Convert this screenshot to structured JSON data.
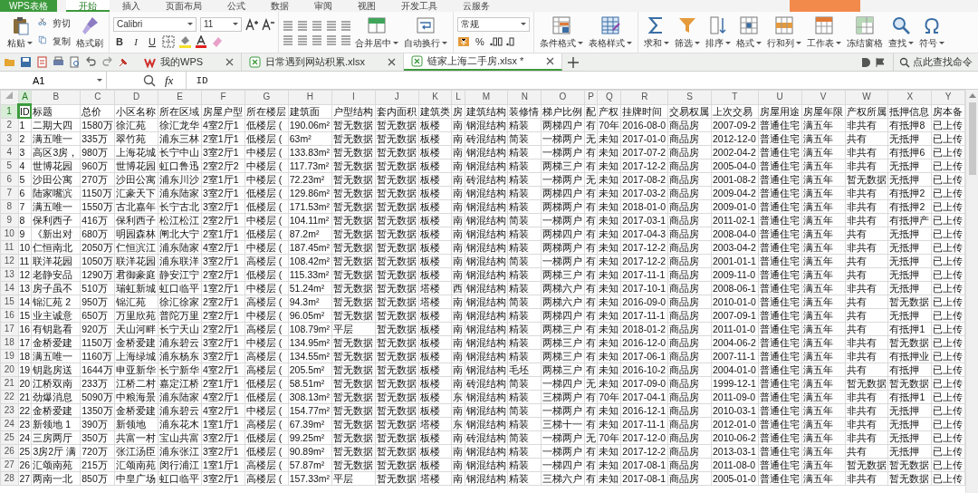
{
  "app": {
    "logo": "WPS表格"
  },
  "ribbon_tabs": [
    {
      "label": "开始",
      "selected": true
    },
    {
      "label": "插入",
      "selected": false
    },
    {
      "label": "页面布局",
      "selected": false
    },
    {
      "label": "公式",
      "selected": false
    },
    {
      "label": "数据",
      "selected": false
    },
    {
      "label": "审阅",
      "selected": false
    },
    {
      "label": "视图",
      "selected": false
    },
    {
      "label": "开发工具",
      "selected": false
    },
    {
      "label": "云服务",
      "selected": false
    }
  ],
  "ribbon": {
    "paste": {
      "label": "粘贴"
    },
    "small_tools": [
      {
        "label": "剪切"
      },
      {
        "label": "复制"
      }
    ],
    "brush": {
      "label": "格式刷"
    },
    "font_name": "Calibri",
    "font_size": "11",
    "format_buttons": [
      {
        "label": "B",
        "kind": "bold"
      },
      {
        "label": "I",
        "kind": "italic"
      },
      {
        "label": "U",
        "kind": "underline"
      }
    ],
    "merge_buttons": [
      {
        "label": "合并居中"
      },
      {
        "label": "自动换行"
      }
    ],
    "number_format": "常规",
    "percent": "%",
    "tools": [
      {
        "label": "条件格式",
        "caret": true
      },
      {
        "label": "表格样式",
        "caret": true
      },
      {
        "label": "求和",
        "caret": true
      },
      {
        "label": "筛选",
        "caret": true
      },
      {
        "label": "排序",
        "caret": true
      },
      {
        "label": "格式",
        "caret": true
      },
      {
        "label": "行和列",
        "caret": true
      },
      {
        "label": "工作表",
        "caret": true
      },
      {
        "label": "冻结窗格",
        "caret": false
      },
      {
        "label": "查找",
        "caret": true
      },
      {
        "label": "符号",
        "caret": true
      }
    ]
  },
  "doc_tabs": [
    {
      "label": "我的WPS",
      "selected": false
    },
    {
      "label": "日常遇到网站积累.xlsx",
      "selected": false
    },
    {
      "label": "链家上海二手房.xlsx *",
      "selected": true
    }
  ],
  "command_search": {
    "label": "点此查找命令"
  },
  "formula_bar": {
    "name_box": "A1",
    "fx": "fx",
    "formula": "ID"
  },
  "sheet": {
    "columns": [
      {
        "letter": "A",
        "selected": true
      },
      {
        "letter": "B",
        "selected": false
      },
      {
        "letter": "C",
        "selected": false
      },
      {
        "letter": "D",
        "selected": false
      },
      {
        "letter": "E",
        "selected": false
      },
      {
        "letter": "F",
        "selected": false
      },
      {
        "letter": "G",
        "selected": false
      },
      {
        "letter": "H",
        "selected": false
      },
      {
        "letter": "I",
        "selected": false
      },
      {
        "letter": "J",
        "selected": false
      },
      {
        "letter": "K",
        "selected": false
      },
      {
        "letter": "L",
        "selected": false
      },
      {
        "letter": "M",
        "selected": false
      },
      {
        "letter": "N",
        "selected": false
      },
      {
        "letter": "O",
        "selected": false
      },
      {
        "letter": "P",
        "selected": false
      },
      {
        "letter": "Q",
        "selected": false
      },
      {
        "letter": "R",
        "selected": false
      },
      {
        "letter": "S",
        "selected": false
      },
      {
        "letter": "T",
        "selected": false
      },
      {
        "letter": "U",
        "selected": false
      },
      {
        "letter": "V",
        "selected": false
      },
      {
        "letter": "W",
        "selected": false
      },
      {
        "letter": "X",
        "selected": false
      },
      {
        "letter": "Y",
        "selected": false
      }
    ],
    "rows": [
      {
        "number": "1",
        "selected": true,
        "cells": [
          "ID",
          "标题",
          "总价",
          "小区名称",
          "所在区域",
          "房屋户型",
          "所在楼层",
          "建筑面",
          "户型结构",
          "套内面积",
          "建筑类",
          "房",
          "建筑结构",
          "装修情",
          "梯户比例",
          "配",
          "产权",
          "挂牌时间",
          "交易权属",
          "上次交易",
          "房屋用途",
          "房屋年限",
          "产权所属",
          "抵押信息",
          "房本备"
        ]
      },
      {
        "number": "2",
        "selected": false,
        "cells": [
          "1",
          "二期大四",
          "1580万",
          "徐汇苑",
          "徐汇龙华",
          "4室2厅1",
          "低楼层 (",
          "190.06m²",
          "暂无数据",
          "暂无数据",
          "板楼",
          "南",
          "钢混结构",
          "精装",
          "两梯四户",
          "有",
          "70年",
          "2016-08-0",
          "商品房",
          "2007-09-2",
          "普通住宅",
          "满五年",
          "非共有",
          "有抵押8",
          "已上传"
        ]
      },
      {
        "number": "3",
        "selected": false,
        "cells": [
          "2",
          "满五唯一",
          "335万",
          "翠竹苑",
          "浦东三林",
          "2室1厅1",
          "低楼层 (",
          "63m²",
          "暂无数据",
          "暂无数据",
          "板楼",
          "南",
          "砖混结构",
          "简装",
          "一梯两户",
          "无",
          "未知",
          "2017-01-0",
          "商品房",
          "2012-12-0",
          "普通住宅",
          "满五年",
          "共有",
          "无抵押",
          "已上传"
        ]
      },
      {
        "number": "4",
        "selected": false,
        "cells": [
          "3",
          "高区3房，",
          "980万",
          "上海花城",
          "长宁中山",
          "3室2厅1",
          "中楼层 (",
          "133.83m²",
          "暂无数据",
          "暂无数据",
          "板楼",
          "南",
          "钢混结构",
          "精装",
          "一梯两户",
          "有",
          "未知",
          "2017-07-2",
          "商品房",
          "2002-04-2",
          "普通住宅",
          "满五年",
          "非共有",
          "有抵押6",
          "已上传"
        ]
      },
      {
        "number": "5",
        "selected": false,
        "cells": [
          "4",
          "世博花园",
          "960万",
          "世博花园",
          "虹口鲁迅",
          "2室2厅2",
          "中楼层 (",
          "117.73m²",
          "暂无数据",
          "暂无数据",
          "板楼",
          "南",
          "钢混结构",
          "精装",
          "两梯三户",
          "有",
          "未知",
          "2017-12-2",
          "商品房",
          "2005-04-0",
          "普通住宅",
          "满五年",
          "非共有",
          "无抵押",
          "已上传"
        ]
      },
      {
        "number": "6",
        "selected": false,
        "cells": [
          "5",
          "沙田公寓",
          "270万",
          "沙田公寓",
          "浦东川沙",
          "2室1厅1",
          "中楼层 (",
          "72.23m²",
          "暂无数据",
          "暂无数据",
          "板楼",
          "南",
          "砖混结构",
          "精装",
          "一梯两户",
          "无",
          "未知",
          "2017-08-2",
          "商品房",
          "2001-08-2",
          "普通住宅",
          "满五年",
          "暂无数据",
          "无抵押",
          "已上传"
        ]
      },
      {
        "number": "7",
        "selected": false,
        "cells": [
          "6",
          "陆家嘴滨",
          "1150万",
          "汇豪天下",
          "浦东陆家",
          "3室2厅1",
          "低楼层 (",
          "129.86m²",
          "暂无数据",
          "暂无数据",
          "板楼",
          "南",
          "钢混结构",
          "精装",
          "两梯四户",
          "有",
          "未知",
          "2017-03-2",
          "商品房",
          "2009-04-2",
          "普通住宅",
          "满五年",
          "非共有",
          "有抵押2",
          "已上传"
        ]
      },
      {
        "number": "8",
        "selected": false,
        "cells": [
          "7",
          "满五唯一",
          "1550万",
          "古北嘉年",
          "长宁古北",
          "3室2厅1",
          "低楼层 (",
          "171.53m²",
          "暂无数据",
          "暂无数据",
          "板楼",
          "南",
          "钢混结构",
          "精装",
          "两梯两户",
          "有",
          "未知",
          "2018-01-0",
          "商品房",
          "2009-01-0",
          "普通住宅",
          "满五年",
          "非共有",
          "有抵押2",
          "已上传"
        ]
      },
      {
        "number": "9",
        "selected": false,
        "cells": [
          "8",
          "保利西子",
          "416万",
          "保利西子",
          "松江松江",
          "2室2厅1",
          "中楼层 (",
          "104.11m²",
          "暂无数据",
          "暂无数据",
          "板楼",
          "南",
          "钢混结构",
          "简装",
          "一梯两户",
          "有",
          "未知",
          "2017-03-1",
          "商品房",
          "2011-02-1",
          "普通住宅",
          "满五年",
          "非共有",
          "有抵押产",
          "已上传"
        ]
      },
      {
        "number": "10",
        "selected": false,
        "cells": [
          "9",
          "《新出对",
          "680万",
          "明园森林",
          "闸北大宁",
          "2室1厅1",
          "低楼层 (",
          "87.2m²",
          "暂无数据",
          "暂无数据",
          "板楼",
          "南",
          "钢混结构",
          "精装",
          "两梯四户",
          "有",
          "未知",
          "2017-04-3",
          "商品房",
          "2008-04-0",
          "普通住宅",
          "满五年",
          "共有",
          "无抵押",
          "已上传"
        ]
      },
      {
        "number": "11",
        "selected": false,
        "cells": [
          "10",
          "仁恒南北",
          "2050万",
          "仁恒滨江",
          "浦东陆家",
          "4室2厅1",
          "中楼层 (",
          "187.45m²",
          "暂无数据",
          "暂无数据",
          "板楼",
          "南",
          "钢混结构",
          "精装",
          "两梯两户",
          "有",
          "未知",
          "2017-12-2",
          "商品房",
          "2003-04-2",
          "普通住宅",
          "满五年",
          "非共有",
          "无抵押",
          "已上传"
        ]
      },
      {
        "number": "12",
        "selected": false,
        "cells": [
          "11",
          "联洋花园",
          "1050万",
          "联洋花园",
          "浦东联洋",
          "3室2厅1",
          "高楼层 (",
          "108.42m²",
          "暂无数据",
          "暂无数据",
          "板楼",
          "南",
          "钢混结构",
          "简装",
          "一梯两户",
          "有",
          "未知",
          "2017-12-2",
          "商品房",
          "2001-01-1",
          "普通住宅",
          "满五年",
          "共有",
          "无抵押",
          "已上传"
        ]
      },
      {
        "number": "13",
        "selected": false,
        "cells": [
          "12",
          "老静安品",
          "1290万",
          "君御豪庭",
          "静安江宁",
          "2室2厅1",
          "低楼层 (",
          "115.33m²",
          "暂无数据",
          "暂无数据",
          "板楼",
          "南",
          "钢混结构",
          "精装",
          "两梯三户",
          "有",
          "未知",
          "2017-11-1",
          "商品房",
          "2009-11-0",
          "普通住宅",
          "满五年",
          "共有",
          "无抵押",
          "已上传"
        ]
      },
      {
        "number": "14",
        "selected": false,
        "cells": [
          "13",
          "房子虽不",
          "510万",
          "瑞虹新城",
          "虹口临平",
          "1室2厅1",
          "中楼层 (",
          "51.24m²",
          "暂无数据",
          "暂无数据",
          "塔楼",
          "西",
          "钢混结构",
          "精装",
          "两梯六户",
          "有",
          "未知",
          "2017-10-1",
          "商品房",
          "2008-06-1",
          "普通住宅",
          "满五年",
          "非共有",
          "无抵押",
          "已上传"
        ]
      },
      {
        "number": "15",
        "selected": false,
        "cells": [
          "14",
          "锦汇苑 2",
          "950万",
          "锦汇苑",
          "徐汇徐家",
          "2室2厅1",
          "高楼层 (",
          "94.3m²",
          "暂无数据",
          "暂无数据",
          "塔楼",
          "南",
          "钢混结构",
          "简装",
          "两梯六户",
          "有",
          "未知",
          "2016-09-0",
          "商品房",
          "2010-01-0",
          "普通住宅",
          "满五年",
          "共有",
          "暂无数据",
          "已上传"
        ]
      },
      {
        "number": "16",
        "selected": false,
        "cells": [
          "15",
          "业主诚意",
          "650万",
          "万里欣苑",
          "普陀万里",
          "2室2厅1",
          "中楼层 (",
          "96.05m²",
          "暂无数据",
          "暂无数据",
          "板楼",
          "南",
          "钢混结构",
          "精装",
          "两梯四户",
          "有",
          "未知",
          "2017-11-1",
          "商品房",
          "2007-09-1",
          "普通住宅",
          "满五年",
          "共有",
          "无抵押",
          "已上传"
        ]
      },
      {
        "number": "17",
        "selected": false,
        "cells": [
          "16",
          "有钥匙看",
          "920万",
          "天山河畔",
          "长宁天山",
          "2室2厅1",
          "高楼层 (",
          "108.79m²",
          "平层",
          "暂无数据",
          "板楼",
          "南",
          "钢混结构",
          "精装",
          "两梯三户",
          "有",
          "未知",
          "2018-01-2",
          "商品房",
          "2011-01-0",
          "普通住宅",
          "满五年",
          "共有",
          "有抵押1",
          "已上传"
        ]
      },
      {
        "number": "18",
        "selected": false,
        "cells": [
          "17",
          "金桥爱建",
          "1150万",
          "金桥爱建",
          "浦东碧云",
          "3室2厅1",
          "中楼层 (",
          "134.95m²",
          "暂无数据",
          "暂无数据",
          "板楼",
          "南",
          "钢混结构",
          "精装",
          "两梯三户",
          "有",
          "未知",
          "2016-12-0",
          "商品房",
          "2004-06-2",
          "普通住宅",
          "满五年",
          "非共有",
          "暂无数据",
          "已上传"
        ]
      },
      {
        "number": "19",
        "selected": false,
        "cells": [
          "18",
          "满五唯一",
          "1160万",
          "上海绿城",
          "浦东杨东",
          "3室2厅1",
          "高楼层 (",
          "134.55m²",
          "暂无数据",
          "暂无数据",
          "板楼",
          "南",
          "钢混结构",
          "精装",
          "两梯三户",
          "有",
          "未知",
          "2017-06-1",
          "商品房",
          "2007-11-1",
          "普通住宅",
          "满五年",
          "非共有",
          "有抵押业",
          "已上传"
        ]
      },
      {
        "number": "20",
        "selected": false,
        "cells": [
          "19",
          "钥匙房送",
          "1644万",
          "申亚新华",
          "长宁新华",
          "4室2厅1",
          "高楼层 (",
          "205.5m²",
          "暂无数据",
          "暂无数据",
          "板楼",
          "南",
          "钢混结构",
          "毛坯",
          "两梯三户",
          "有",
          "未知",
          "2016-10-2",
          "商品房",
          "2004-01-0",
          "普通住宅",
          "满五年",
          "共有",
          "有抵押",
          "已上传"
        ]
      },
      {
        "number": "21",
        "selected": false,
        "cells": [
          "20",
          "江桥双南",
          "233万",
          "江桥二村",
          "嘉定江桥",
          "2室1厅1",
          "低楼层 (",
          "58.51m²",
          "暂无数据",
          "暂无数据",
          "板楼",
          "南",
          "砖混结构",
          "简装",
          "一梯四户",
          "无",
          "未知",
          "2017-09-0",
          "商品房",
          "1999-12-1",
          "普通住宅",
          "满五年",
          "暂无数据",
          "暂无数据",
          "已上传"
        ]
      },
      {
        "number": "22",
        "selected": false,
        "cells": [
          "21",
          "劲爆消息",
          "5090万",
          "中粮海景",
          "浦东陆家",
          "4室2厅1",
          "低楼层 (",
          "308.13m²",
          "暂无数据",
          "暂无数据",
          "板楼",
          "东",
          "钢混结构",
          "精装",
          "三梯两户",
          "有",
          "70年",
          "2017-04-1",
          "商品房",
          "2011-09-0",
          "普通住宅",
          "满五年",
          "非共有",
          "有抵押1",
          "已上传"
        ]
      },
      {
        "number": "23",
        "selected": false,
        "cells": [
          "22",
          "金桥爱建",
          "1350万",
          "金桥爱建",
          "浦东碧云",
          "4室2厅1",
          "中楼层 (",
          "154.77m²",
          "暂无数据",
          "暂无数据",
          "板楼",
          "南",
          "钢混结构",
          "简装",
          "一梯两户",
          "有",
          "未知",
          "2016-12-1",
          "商品房",
          "2010-03-1",
          "普通住宅",
          "满五年",
          "非共有",
          "无抵押",
          "已上传"
        ]
      },
      {
        "number": "24",
        "selected": false,
        "cells": [
          "23",
          "新领地 1",
          "390万",
          "新领地",
          "浦东花木",
          "1室1厅1",
          "高楼层 (",
          "67.39m²",
          "暂无数据",
          "暂无数据",
          "塔楼",
          "东",
          "钢混结构",
          "精装",
          "三梯十一",
          "有",
          "未知",
          "2017-11-1",
          "商品房",
          "2012-01-0",
          "普通住宅",
          "满五年",
          "非共有",
          "无抵押",
          "已上传"
        ]
      },
      {
        "number": "25",
        "selected": false,
        "cells": [
          "24",
          "三房两厅",
          "350万",
          "共富一村",
          "宝山共富",
          "3室2厅1",
          "低楼层 (",
          "99.25m²",
          "暂无数据",
          "暂无数据",
          "板楼",
          "南",
          "砖混结构",
          "简装",
          "一梯两户",
          "无",
          "70年",
          "2017-12-0",
          "商品房",
          "2010-06-2",
          "普通住宅",
          "满五年",
          "非共有",
          "无抵押",
          "已上传"
        ]
      },
      {
        "number": "26",
        "selected": false,
        "cells": [
          "25",
          "3房2厅 满",
          "720万",
          "张江汤臣",
          "浦东张江",
          "3室2厅1",
          "低楼层 (",
          "90.89m²",
          "暂无数据",
          "暂无数据",
          "板楼",
          "南",
          "钢混结构",
          "精装",
          "一梯两户",
          "有",
          "未知",
          "2017-12-2",
          "商品房",
          "2013-03-1",
          "普通住宅",
          "满五年",
          "共有",
          "无抵押",
          "已上传"
        ]
      },
      {
        "number": "27",
        "selected": false,
        "cells": [
          "26",
          "汇颂南苑",
          "215万",
          "汇颂南苑",
          "闵行浦江",
          "1室1厅1",
          "高楼层 (",
          "57.87m²",
          "暂无数据",
          "暂无数据",
          "板楼",
          "南",
          "钢混结构",
          "精装",
          "一梯四户",
          "有",
          "未知",
          "2017-08-1",
          "商品房",
          "2011-08-0",
          "普通住宅",
          "满五年",
          "暂无数据",
          "暂无数据",
          "已上传"
        ]
      },
      {
        "number": "28",
        "selected": false,
        "cells": [
          "27",
          "两南一北",
          "850万",
          "中皇广场",
          "虹口临平",
          "3室2厅1",
          "高楼层 (",
          "157.33m²",
          "平层",
          "暂无数据",
          "塔楼",
          "南",
          "钢混结构",
          "精装",
          "三梯六户",
          "有",
          "未知",
          "2017-08-1",
          "商品房",
          "2005-01-0",
          "普通住宅",
          "满五年",
          "非共有",
          "暂无数据",
          "已上传"
        ]
      }
    ]
  }
}
